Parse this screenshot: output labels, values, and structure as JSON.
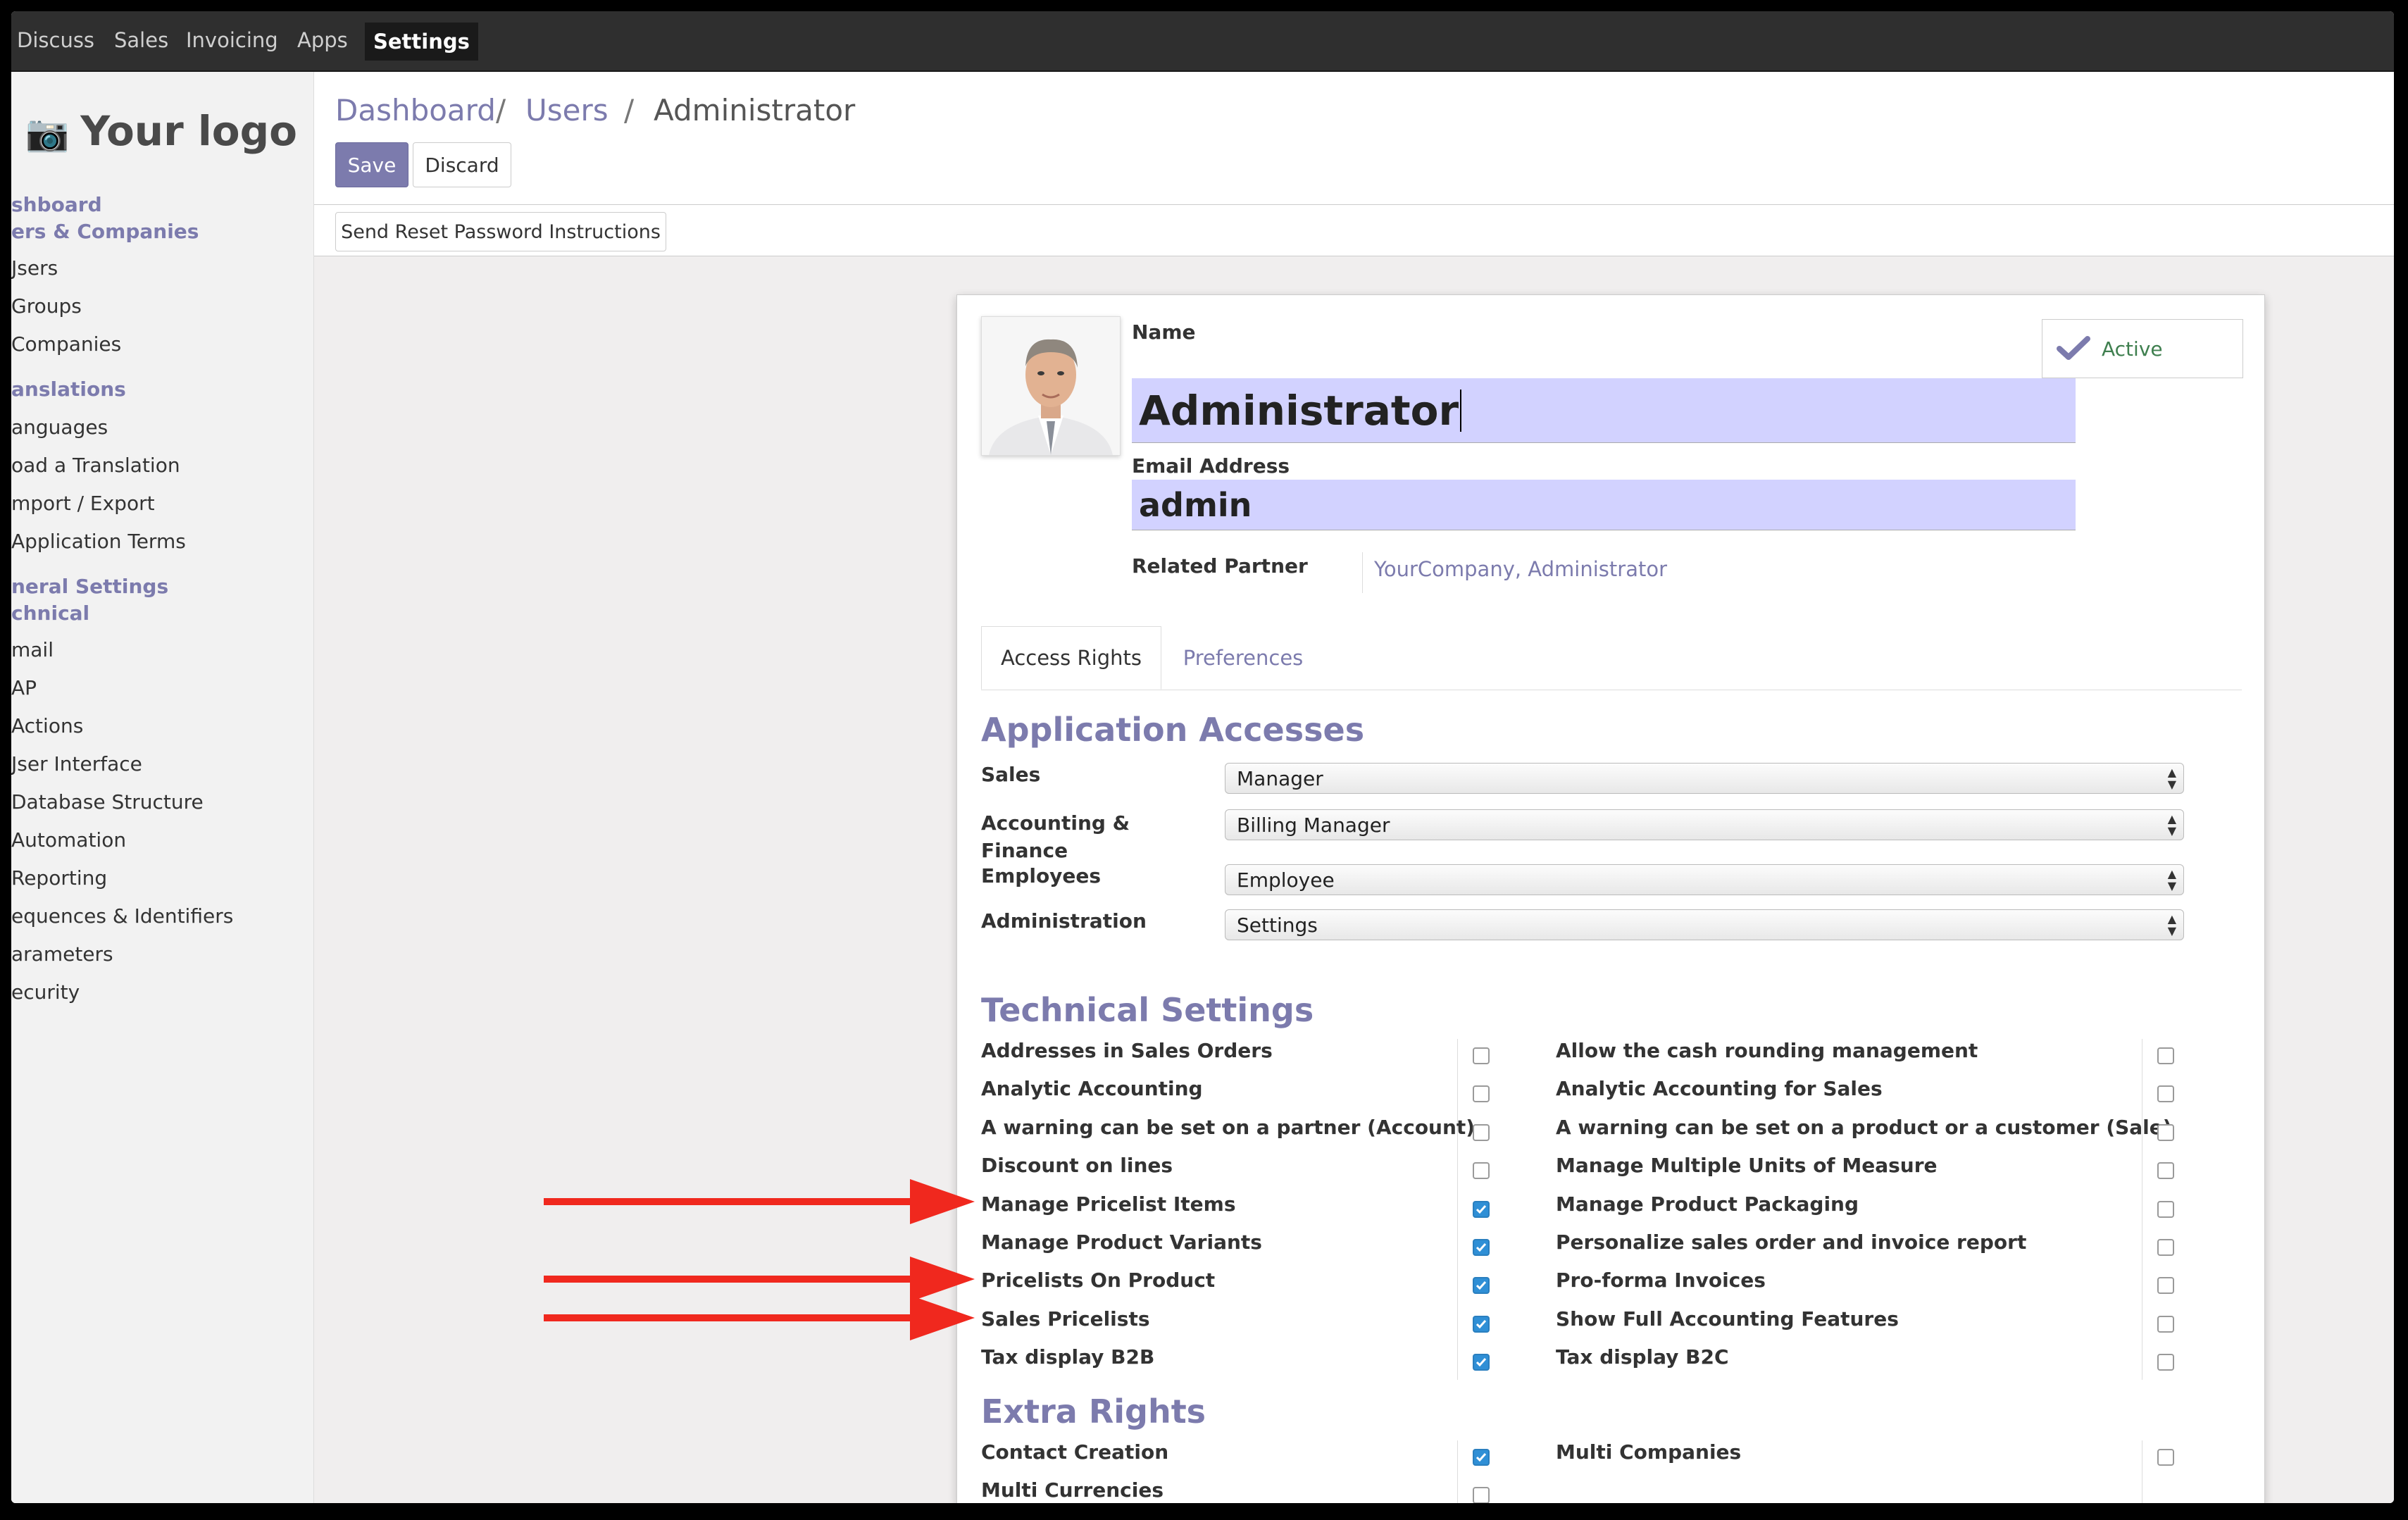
{
  "topnav": {
    "items": [
      "Discuss",
      "Sales",
      "Invoicing",
      "Apps",
      "Settings"
    ],
    "active": "Settings"
  },
  "sidebar": {
    "logo": "Your logo",
    "items": [
      "shboard",
      "ers & Companies",
      "Jsers",
      "Groups",
      "Companies",
      "anslations",
      "anguages",
      "oad a Translation",
      "mport / Export",
      "Application Terms",
      "neral Settings",
      "chnical",
      "mail",
      "AP",
      "Actions",
      "Jser Interface",
      "Database Structure",
      "Automation",
      "Reporting",
      "equences & Identifiers",
      "arameters",
      "ecurity"
    ]
  },
  "breadcrumb": {
    "items": [
      "Dashboard",
      "Users",
      "Administrator"
    ],
    "separator": "/"
  },
  "buttons": {
    "save": "Save",
    "discard": "Discard",
    "reset_password": "Send Reset Password Instructions"
  },
  "user": {
    "name_label": "Name",
    "name": "Administrator",
    "email_label": "Email Address",
    "email": "admin",
    "partner_label": "Related Partner",
    "partner": "YourCompany, Administrator",
    "active_label": "Active"
  },
  "tabs": [
    "Access Rights",
    "Preferences"
  ],
  "application_accesses": {
    "title": "Application Accesses",
    "rows": [
      {
        "label": "Sales",
        "value": "Manager"
      },
      {
        "label": "Accounting & Finance",
        "value": "Billing Manager"
      },
      {
        "label": "Employees",
        "value": "Employee"
      },
      {
        "label": "Administration",
        "value": "Settings"
      }
    ]
  },
  "technical_settings": {
    "title": "Technical Settings",
    "left": [
      {
        "label": "Addresses in Sales Orders",
        "checked": false
      },
      {
        "label": "Analytic Accounting",
        "checked": false
      },
      {
        "label": "A warning can be set on a partner (Account)",
        "checked": false
      },
      {
        "label": "Discount on lines",
        "checked": false
      },
      {
        "label": "Manage Pricelist Items",
        "checked": true
      },
      {
        "label": "Manage Product Variants",
        "checked": true
      },
      {
        "label": "Pricelists On Product",
        "checked": true
      },
      {
        "label": "Sales Pricelists",
        "checked": true
      },
      {
        "label": "Tax display B2B",
        "checked": true
      }
    ],
    "right": [
      {
        "label": "Allow the cash rounding management",
        "checked": false
      },
      {
        "label": "Analytic Accounting for Sales",
        "checked": false
      },
      {
        "label": "A warning can be set on a product or a customer (Sale)",
        "checked": false
      },
      {
        "label": "Manage Multiple Units of Measure",
        "checked": false
      },
      {
        "label": "Manage Product Packaging",
        "checked": false
      },
      {
        "label": "Personalize sales order and invoice report",
        "checked": false
      },
      {
        "label": "Pro-forma Invoices",
        "checked": false
      },
      {
        "label": "Show Full Accounting Features",
        "checked": false
      },
      {
        "label": "Tax display B2C",
        "checked": false
      }
    ]
  },
  "extra_rights": {
    "title": "Extra Rights",
    "left": [
      {
        "label": "Contact Creation",
        "checked": true
      },
      {
        "label": "Multi Currencies",
        "checked": false
      }
    ],
    "right": [
      {
        "label": "Multi Companies",
        "checked": false
      }
    ]
  },
  "colors": {
    "accent": "#7c7bad",
    "topbar": "#2f2f2f",
    "input_highlight": "#d2d2ff",
    "checkbox_on": "#2f8fd6",
    "annotation_arrow": "#f0281e"
  }
}
